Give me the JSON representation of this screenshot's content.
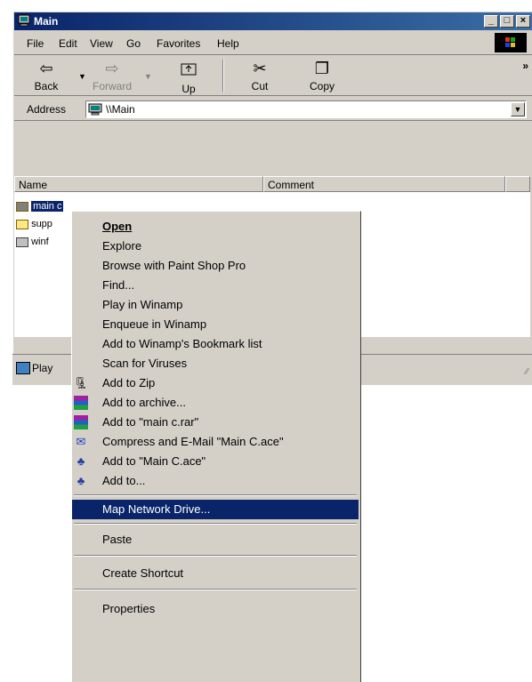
{
  "window": {
    "title": "Main"
  },
  "menubar": {
    "items": [
      "File",
      "Edit",
      "View",
      "Go",
      "Favorites",
      "Help"
    ]
  },
  "toolbar": {
    "back": "Back",
    "forward": "Forward",
    "up": "Up",
    "cut": "Cut",
    "copy": "Copy",
    "more": "»"
  },
  "address": {
    "label": "Address",
    "value": "\\\\Main"
  },
  "columns": {
    "name": "Name",
    "comment": "Comment"
  },
  "files": [
    "main c",
    "supp",
    "winf"
  ],
  "status": {
    "text": "Play"
  },
  "context_menu": {
    "open": "Open",
    "explore": "Explore",
    "browse": "Browse with Paint Shop Pro",
    "find": "Find...",
    "play": "Play in Winamp",
    "enqueue": "Enqueue in Winamp",
    "bookmark": "Add to Winamp's Bookmark list",
    "scan": "Scan for Viruses",
    "zip": "Add to Zip",
    "archive": "Add to archive...",
    "rar": "Add to \"main c.rar\"",
    "email": "Compress and E-Mail \"Main C.ace\"",
    "ace": "Add to \"Main C.ace\"",
    "addto": "Add to...",
    "map": "Map Network Drive...",
    "paste": "Paste",
    "shortcut": "Create Shortcut",
    "properties": "Properties"
  },
  "colors": {
    "selection": "#0a246a",
    "face": "#d4d0c8"
  }
}
